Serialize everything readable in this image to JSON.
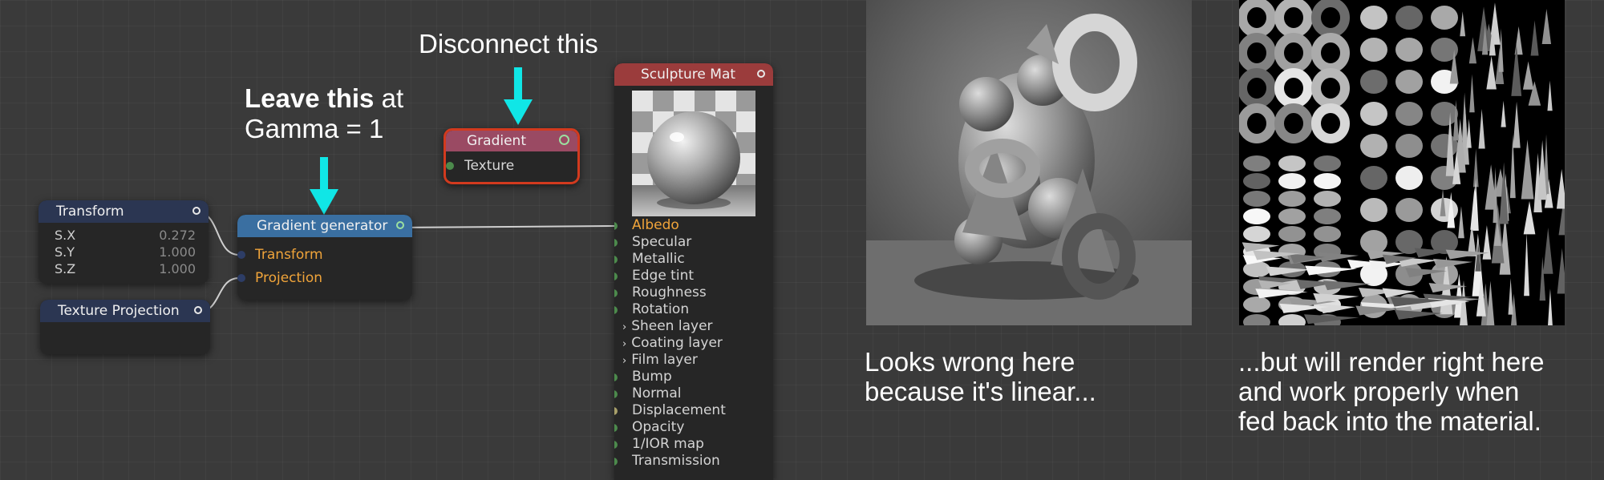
{
  "annotations": {
    "disconnect": "Disconnect this",
    "leave_bold": "Leave this",
    "leave_rest": " at",
    "leave_line2": "Gamma = 1"
  },
  "nodes": {
    "transform": {
      "title": "Transform",
      "params": [
        {
          "label": "S.X",
          "value": "0.272"
        },
        {
          "label": "S.Y",
          "value": "1.000"
        },
        {
          "label": "S.Z",
          "value": "1.000"
        }
      ]
    },
    "texture_projection": {
      "title": "Texture Projection"
    },
    "gradient_generator": {
      "title": "Gradient generator",
      "ports": [
        "Transform",
        "Projection"
      ]
    },
    "gradient": {
      "title": "Gradient",
      "ports": [
        "Texture"
      ]
    },
    "sculpture_mat": {
      "title": "Sculpture Mat",
      "ports": [
        {
          "label": "Albedo",
          "kind": "dot",
          "active": true
        },
        {
          "label": "Specular",
          "kind": "dot"
        },
        {
          "label": "Metallic",
          "kind": "dot"
        },
        {
          "label": "Edge tint",
          "kind": "dot"
        },
        {
          "label": "Roughness",
          "kind": "dot"
        },
        {
          "label": "Rotation",
          "kind": "dot"
        },
        {
          "label": "Sheen layer",
          "kind": "chevron"
        },
        {
          "label": "Coating layer",
          "kind": "chevron"
        },
        {
          "label": "Film layer",
          "kind": "chevron"
        },
        {
          "label": "Bump",
          "kind": "dot"
        },
        {
          "label": "Normal",
          "kind": "dot"
        },
        {
          "label": "Displacement",
          "kind": "dot",
          "olive": true
        },
        {
          "label": "Opacity",
          "kind": "dot"
        },
        {
          "label": "1/IOR map",
          "kind": "dot"
        },
        {
          "label": "Transmission",
          "kind": "dot"
        }
      ]
    }
  },
  "captions": {
    "left": [
      "Looks wrong here",
      "because it's linear..."
    ],
    "right": [
      "...but will render right here",
      "and work properly when",
      "fed back into the material."
    ]
  },
  "colors": {
    "accent_orange": "#f0a43a",
    "arrow_cyan": "#10e6e6",
    "selection_red": "#d23a1e"
  }
}
